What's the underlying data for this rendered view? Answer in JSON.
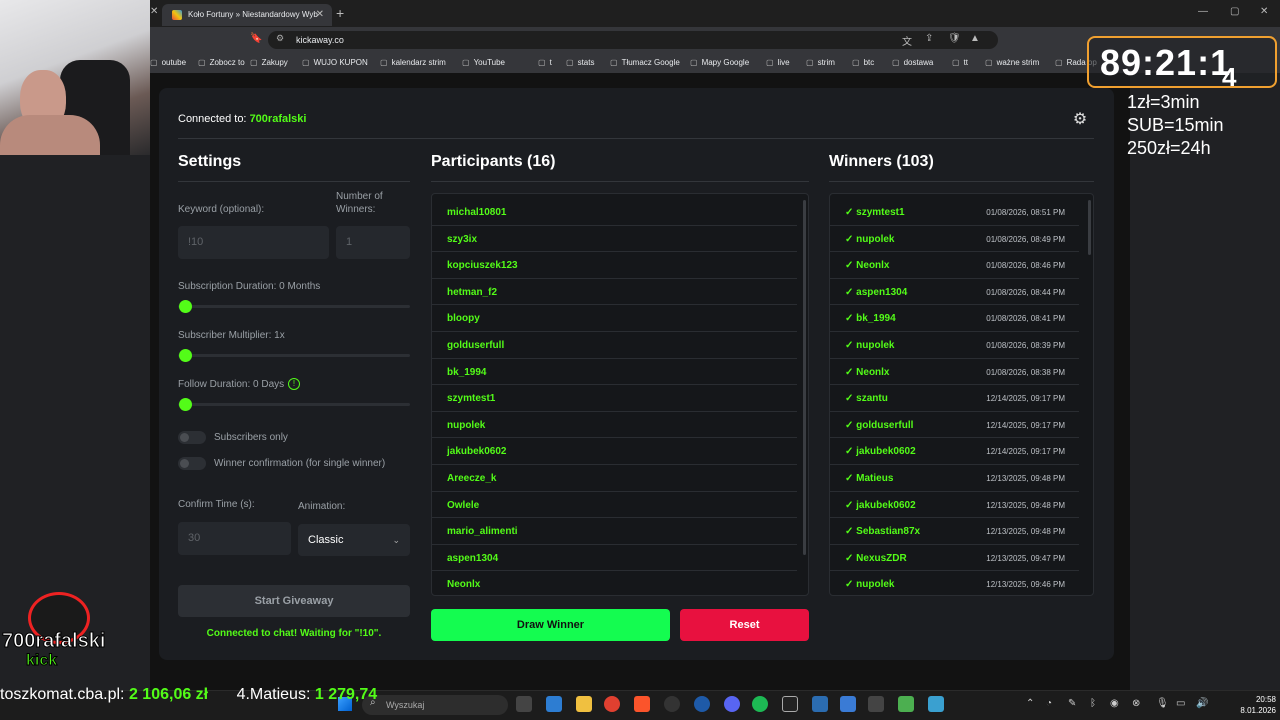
{
  "browser": {
    "tab_title": "Koło Fortuny » Niestandardowy Wyb",
    "url": "kickaway.co",
    "bookmarks": [
      "outube",
      "Zobocz to",
      "Zakupy",
      "WUJO KUPON",
      "kalendarz strim",
      "YouTube",
      "t",
      "stats",
      "Tłumacz Google",
      "Mapy Google",
      "live",
      "strim",
      "btc",
      "dostawa",
      "tt",
      "ważne strim",
      "Rada op"
    ]
  },
  "header": {
    "connected_label": "Connected to:",
    "channel": "700rafalski"
  },
  "settings": {
    "title": "Settings",
    "keyword_label": "Keyword (optional):",
    "keyword_placeholder": "!10",
    "winners_label": "Number of Winners:",
    "winners_placeholder": "1",
    "sub_duration_label": "Subscription Duration: 0 Months",
    "sub_duration_value": 0,
    "sub_multiplier_label": "Subscriber Multiplier: 1x",
    "sub_multiplier_value": 1,
    "follow_duration_label": "Follow Duration: 0 Days",
    "follow_duration_value": 0,
    "subscribers_only_label": "Subscribers only",
    "subscribers_only": false,
    "winner_confirmation_label": "Winner confirmation (for single winner)",
    "winner_confirmation": false,
    "confirm_time_label": "Confirm Time (s):",
    "confirm_time_placeholder": "30",
    "animation_label": "Animation:",
    "animation_value": "Classic",
    "start_button": "Start Giveaway",
    "status": "Connected to chat! Waiting for \"!10\"."
  },
  "participants": {
    "title": "Participants (16)",
    "items": [
      "michal10801",
      "szy3ix",
      "kopciuszek123",
      "hetman_f2",
      "bloopy",
      "golduserfull",
      "bk_1994",
      "szymtest1",
      "nupolek",
      "jakubek0602",
      "Areecze_k",
      "Owlele",
      "mario_alimenti",
      "aspen1304",
      "Neonlx"
    ],
    "draw_button": "Draw Winner",
    "reset_button": "Reset"
  },
  "winners": {
    "title": "Winners (103)",
    "items": [
      {
        "name": "✓ szymtest1",
        "date": "01/08/2026, 08:51 PM"
      },
      {
        "name": "✓ nupolek",
        "date": "01/08/2026, 08:49 PM"
      },
      {
        "name": "✓ Neonlx",
        "date": "01/08/2026, 08:46 PM"
      },
      {
        "name": "✓ aspen1304",
        "date": "01/08/2026, 08:44 PM"
      },
      {
        "name": "✓ bk_1994",
        "date": "01/08/2026, 08:41 PM"
      },
      {
        "name": "✓ nupolek",
        "date": "01/08/2026, 08:39 PM"
      },
      {
        "name": "✓ Neonlx",
        "date": "01/08/2026, 08:38 PM"
      },
      {
        "name": "✓ szantu",
        "date": "12/14/2025, 09:17 PM"
      },
      {
        "name": "✓ golduserfull",
        "date": "12/14/2025, 09:17 PM"
      },
      {
        "name": "✓ jakubek0602",
        "date": "12/14/2025, 09:17 PM"
      },
      {
        "name": "✓ Matieus",
        "date": "12/13/2025, 09:48 PM"
      },
      {
        "name": "✓ jakubek0602",
        "date": "12/13/2025, 09:48 PM"
      },
      {
        "name": "✓ Sebastian87x",
        "date": "12/13/2025, 09:48 PM"
      },
      {
        "name": "✓ NexusZDR",
        "date": "12/13/2025, 09:47 PM"
      },
      {
        "name": "✓ nupolek",
        "date": "12/13/2025, 09:46 PM"
      }
    ]
  },
  "overlay": {
    "timer": "89:21:1",
    "timer_tail": "4",
    "rates": [
      "1zł=3min",
      "SUB=15min",
      "250zł=24h"
    ],
    "logo_name": "700rafalski",
    "logo_kick": "kick",
    "ticker_site": "toszkomat.cba.pl:",
    "ticker_amount1": "2 106,06 zł",
    "ticker_rank": "4.Matieus:",
    "ticker_amount2": "1 279,74"
  },
  "taskbar": {
    "search_placeholder": "Wyszukaj",
    "time": "20:58",
    "date": "8.01.2026"
  },
  "colors": {
    "accent": "#53fc18",
    "draw": "#14fc50",
    "reset": "#e8113f",
    "card": "#1b1d21"
  }
}
